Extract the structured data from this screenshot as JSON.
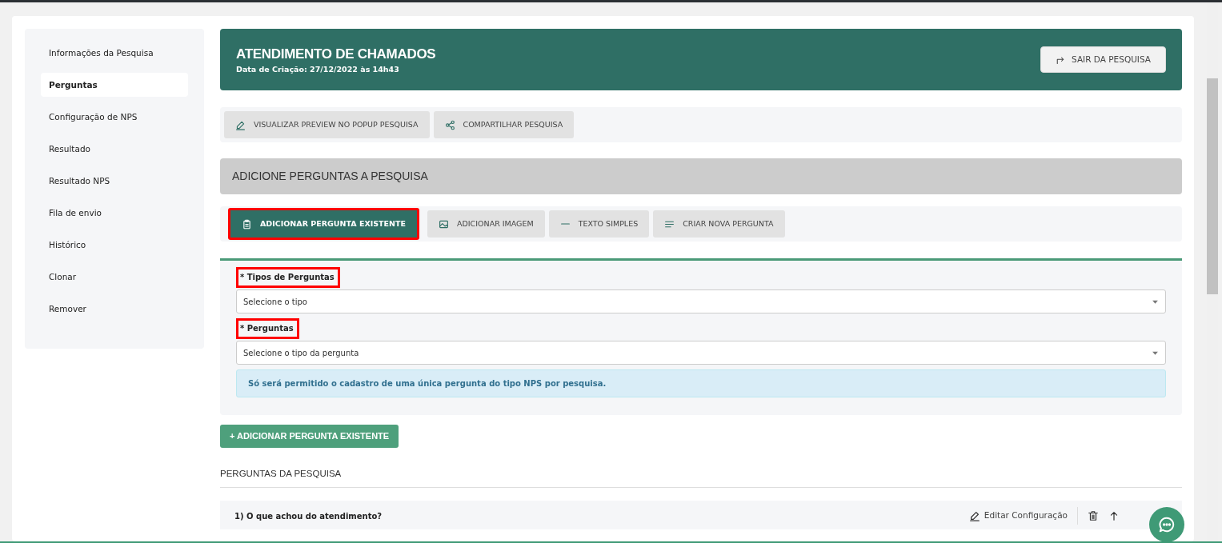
{
  "sidebar": {
    "items": [
      {
        "label": "Informações da Pesquisa",
        "selected": false
      },
      {
        "label": "Perguntas",
        "selected": true
      },
      {
        "label": "Configuração de NPS",
        "selected": false
      },
      {
        "label": "Resultado",
        "selected": false
      },
      {
        "label": "Resultado NPS",
        "selected": false
      },
      {
        "label": "Fila de envio",
        "selected": false
      },
      {
        "label": "Histórico",
        "selected": false
      },
      {
        "label": "Clonar",
        "selected": false
      },
      {
        "label": "Remover",
        "selected": false
      }
    ]
  },
  "header": {
    "title": "ATENDIMENTO DE CHAMADOS",
    "subtitle": "Data de Criação: 27/12/2022 às 14h43",
    "exit_button": "SAIR DA PESQUISA"
  },
  "toolbar": [
    {
      "kind": "pencil",
      "label": "VISUALIZAR PREVIEW NO POPUP PESQUISA"
    },
    {
      "kind": "share",
      "label": "COMPARTILHAR PESQUISA"
    }
  ],
  "section_title": "ADICIONE PERGUNTAS A PESQUISA",
  "tabs": [
    {
      "kind": "clipboard",
      "label": "ADICIONAR PERGUNTA EXISTENTE",
      "selected": true,
      "highlighted": true
    },
    {
      "kind": "image",
      "label": "ADICIONAR IMAGEM",
      "selected": false,
      "highlighted": false
    },
    {
      "kind": "dash",
      "label": "TEXTO SIMPLES",
      "selected": false,
      "highlighted": false
    },
    {
      "kind": "lines",
      "label": "CRIAR NOVA PERGUNTA",
      "selected": false,
      "highlighted": false
    }
  ],
  "form": {
    "fields": [
      {
        "label": "* Tipos de Perguntas",
        "highlighted": true,
        "placeholder": "Selecione o tipo"
      },
      {
        "label": "* Perguntas",
        "highlighted": true,
        "placeholder": "Selecione o tipo da pergunta"
      }
    ],
    "notice": "Só será permitido o cadastro de uma única pergunta do tipo NPS por pesquisa."
  },
  "add_button": "+ ADICIONAR PERGUNTA EXISTENTE",
  "questions_title": "PERGUNTAS DA PESQUISA",
  "questions": [
    {
      "text": "1) O que achou do atendimento?",
      "edit_label": "Editar Configuração"
    }
  ]
}
